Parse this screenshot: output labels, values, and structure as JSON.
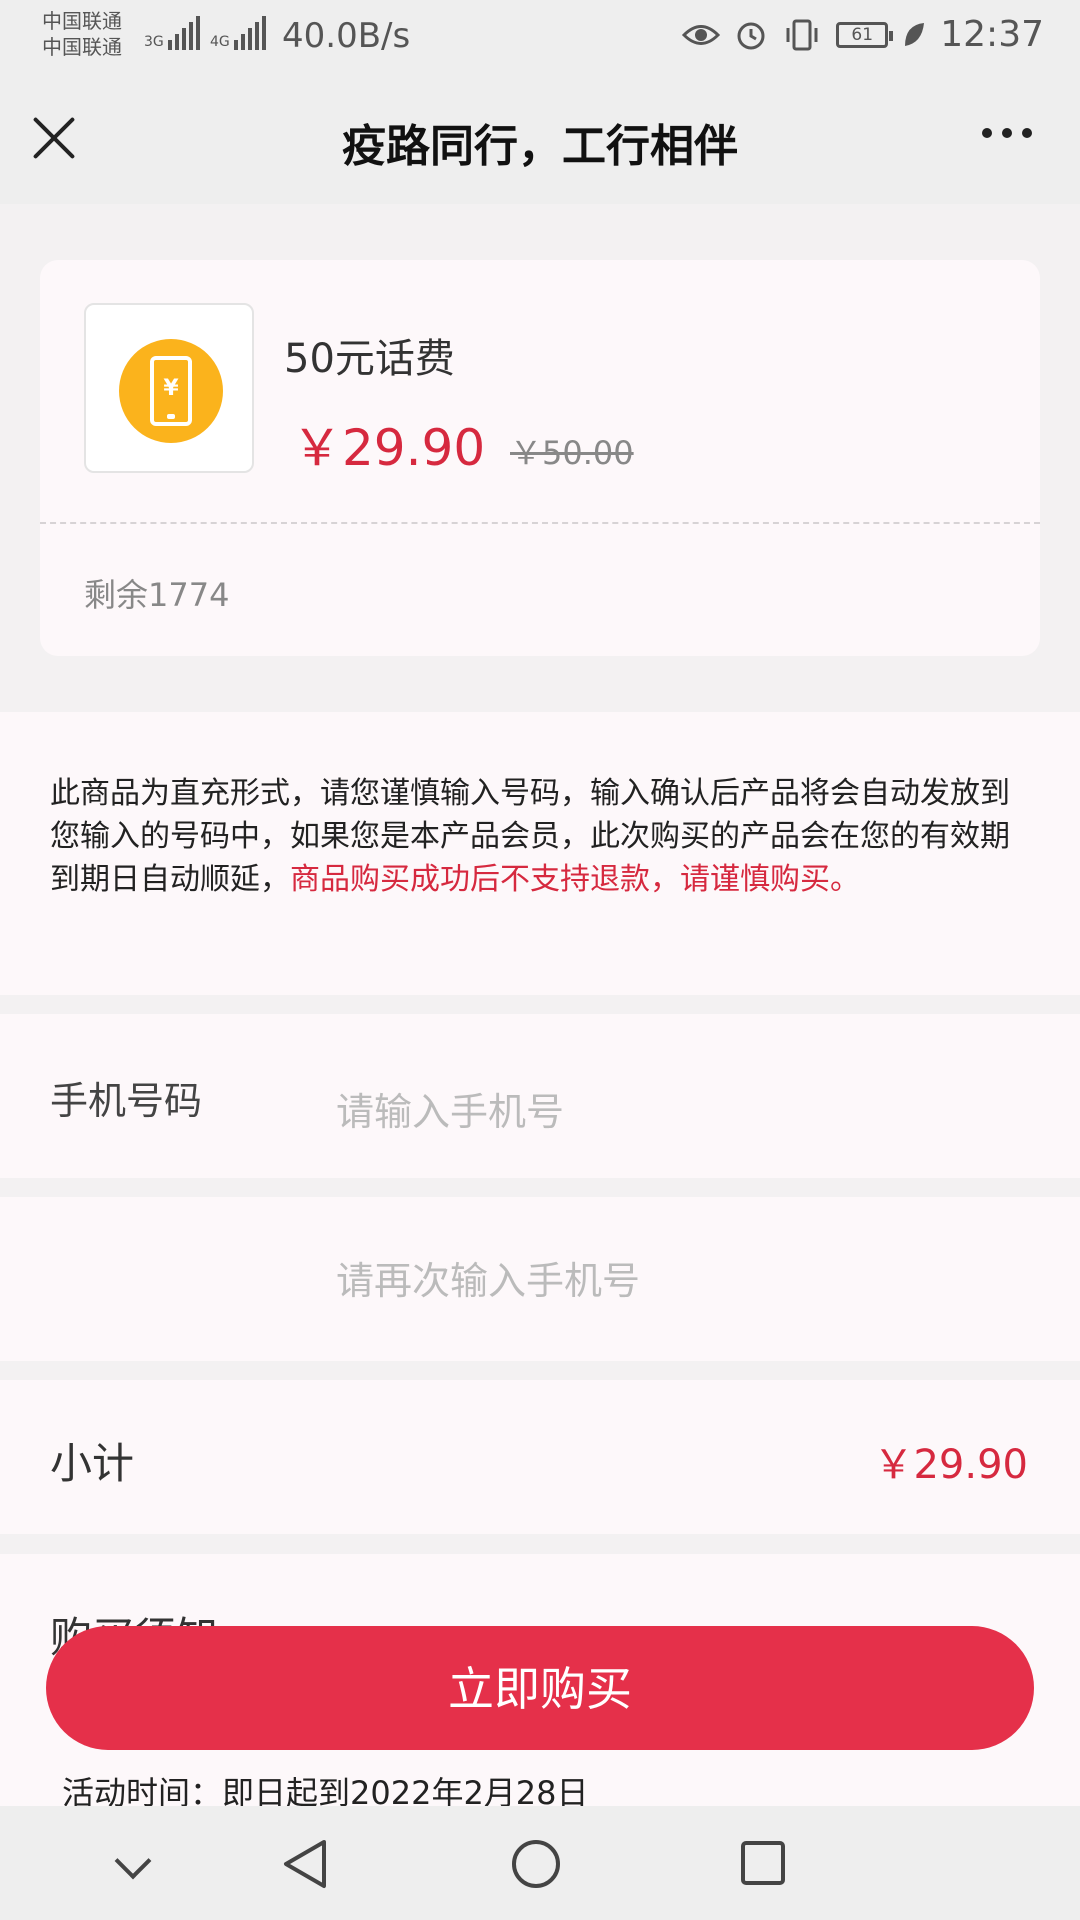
{
  "status_bar": {
    "carrier_1": "中国联通",
    "carrier_2": "中国联通",
    "sig1_type": "3G",
    "sig2_type": "4G",
    "net_speed": "40.0B/s",
    "battery": "61",
    "time": "12:37"
  },
  "header": {
    "title": "疫路同行，工行相伴"
  },
  "product": {
    "name": "50元话费",
    "price": "￥29.90",
    "original_price": "￥50.00",
    "stock": "剩余1774",
    "accent_color": "#fbb31c"
  },
  "notice": {
    "text": "此商品为直充形式，请您谨慎输入号码，输入确认后产品将会自动发放到您输入的号码中，如果您是本产品会员，此次购买的产品会在您的有效期到期日自动顺延，",
    "warning": "商品购买成功后不支持退款，请谨慎购买。"
  },
  "form": {
    "phone_label": "手机号码",
    "phone_placeholder": "请输入手机号",
    "phone_confirm_placeholder": "请再次输入手机号"
  },
  "subtotal": {
    "label": "小计",
    "value": "￥29.90"
  },
  "purchase_notice": {
    "label": "购买须知",
    "activity_time": "活动时间：即日起到2022年2月28日"
  },
  "buy_button": {
    "label": "立即购买",
    "color": "#e5304a"
  },
  "nav_bar": {
    "icons": [
      "chevron-down-icon",
      "back-triangle-icon",
      "home-circle-icon",
      "recent-square-icon"
    ]
  }
}
